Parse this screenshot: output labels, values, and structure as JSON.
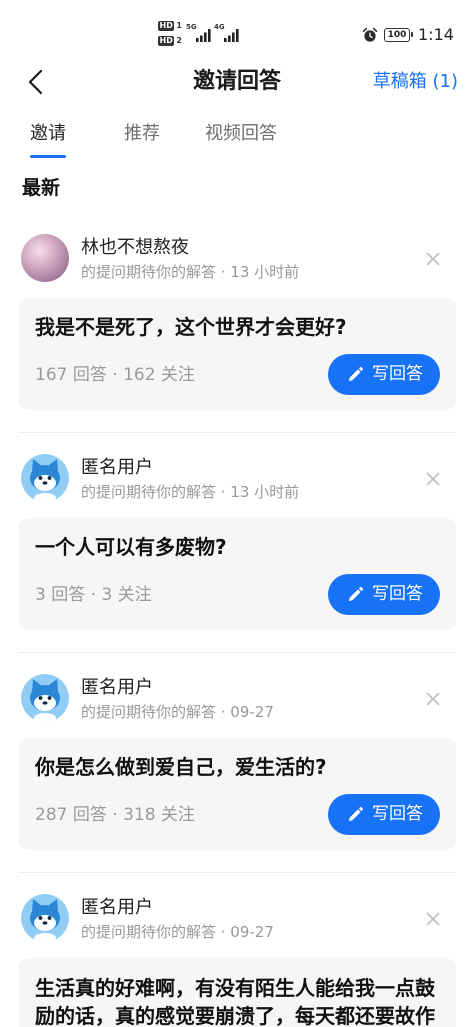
{
  "status_bar": {
    "sim1_badge": "HD",
    "sim1_slot": "1",
    "sim2_badge": "HD",
    "sim2_slot": "2",
    "sim1_network": "5G",
    "sim2_network": "4G",
    "battery": "100",
    "time": "1:14",
    "icons": [
      "signal-icon",
      "alarm-icon",
      "battery-icon"
    ]
  },
  "header": {
    "back_icon": "back-arrow-icon",
    "title": "邀请回答",
    "drafts_label": "草稿箱 (1)"
  },
  "tabs": [
    {
      "label": "邀请",
      "active": true
    },
    {
      "label": "推荐",
      "active": false
    },
    {
      "label": "视频回答",
      "active": false
    }
  ],
  "section_title": "最新",
  "feed": [
    {
      "avatar": "user-photo-avatar",
      "user": "林也不想熬夜",
      "meta": "的提问期待你的解答 · 13 小时前",
      "question": "我是不是死了，这个世界才会更好?",
      "stats": "167 回答 · 162 关注",
      "action": "写回答",
      "dismiss_icon": "close-icon"
    },
    {
      "avatar": "anonymous-avatar",
      "user": "匿名用户",
      "meta": "的提问期待你的解答 · 13 小时前",
      "question": "一个人可以有多废物?",
      "stats": "3 回答 · 3 关注",
      "action": "写回答",
      "dismiss_icon": "close-icon"
    },
    {
      "avatar": "anonymous-avatar",
      "user": "匿名用户",
      "meta": "的提问期待你的解答 · 09-27",
      "question": "你是怎么做到爱自己，爱生活的?",
      "stats": "287 回答 · 318 关注",
      "action": "写回答",
      "dismiss_icon": "close-icon"
    },
    {
      "avatar": "anonymous-avatar",
      "user": "匿名用户",
      "meta": "的提问期待你的解答 · 09-27",
      "question": "生活真的好难啊，有没有陌生人能给我一点鼓励的话，真的感觉要崩溃了，每天都还要故作",
      "dismiss_icon": "close-icon"
    }
  ],
  "colors": {
    "accent": "#1772F6",
    "question_bg": "#F6F6F6",
    "muted_text": "#999999",
    "primary_text": "#1A1A1A"
  }
}
